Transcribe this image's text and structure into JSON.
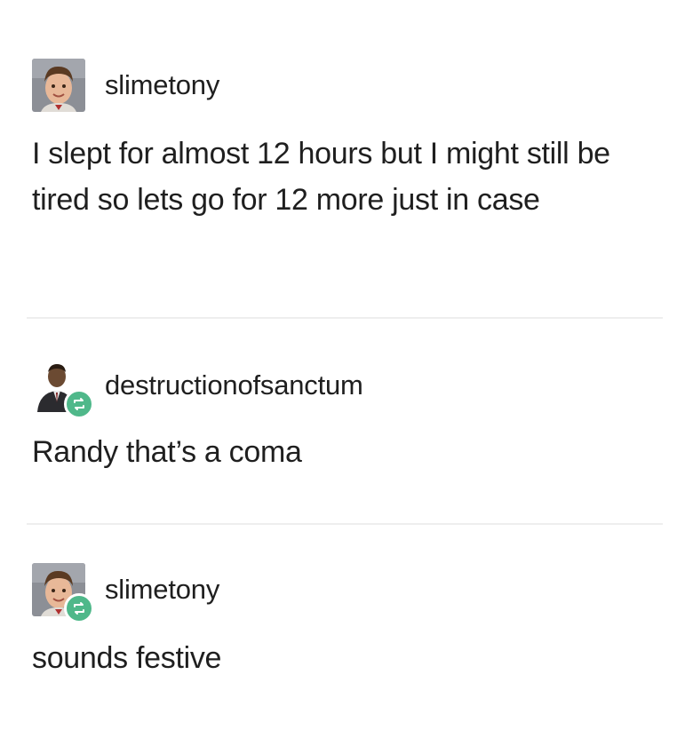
{
  "posts": [
    {
      "username": "slimetony",
      "avatar": "child-portrait-avatar",
      "reblog": false,
      "body": "I slept for almost 12 hours but I might still be tired so lets go for 12 more just in case"
    },
    {
      "username": "destructionofsanctum",
      "avatar": "man-in-suit-avatar",
      "reblog": true,
      "body": "Randy that’s a coma"
    },
    {
      "username": "slimetony",
      "avatar": "child-portrait-avatar",
      "reblog": true,
      "body": "sounds festive"
    }
  ],
  "colors": {
    "reblog_badge": "#4fb88a",
    "text": "#1f1f1f",
    "divider": "#eeeeee"
  }
}
